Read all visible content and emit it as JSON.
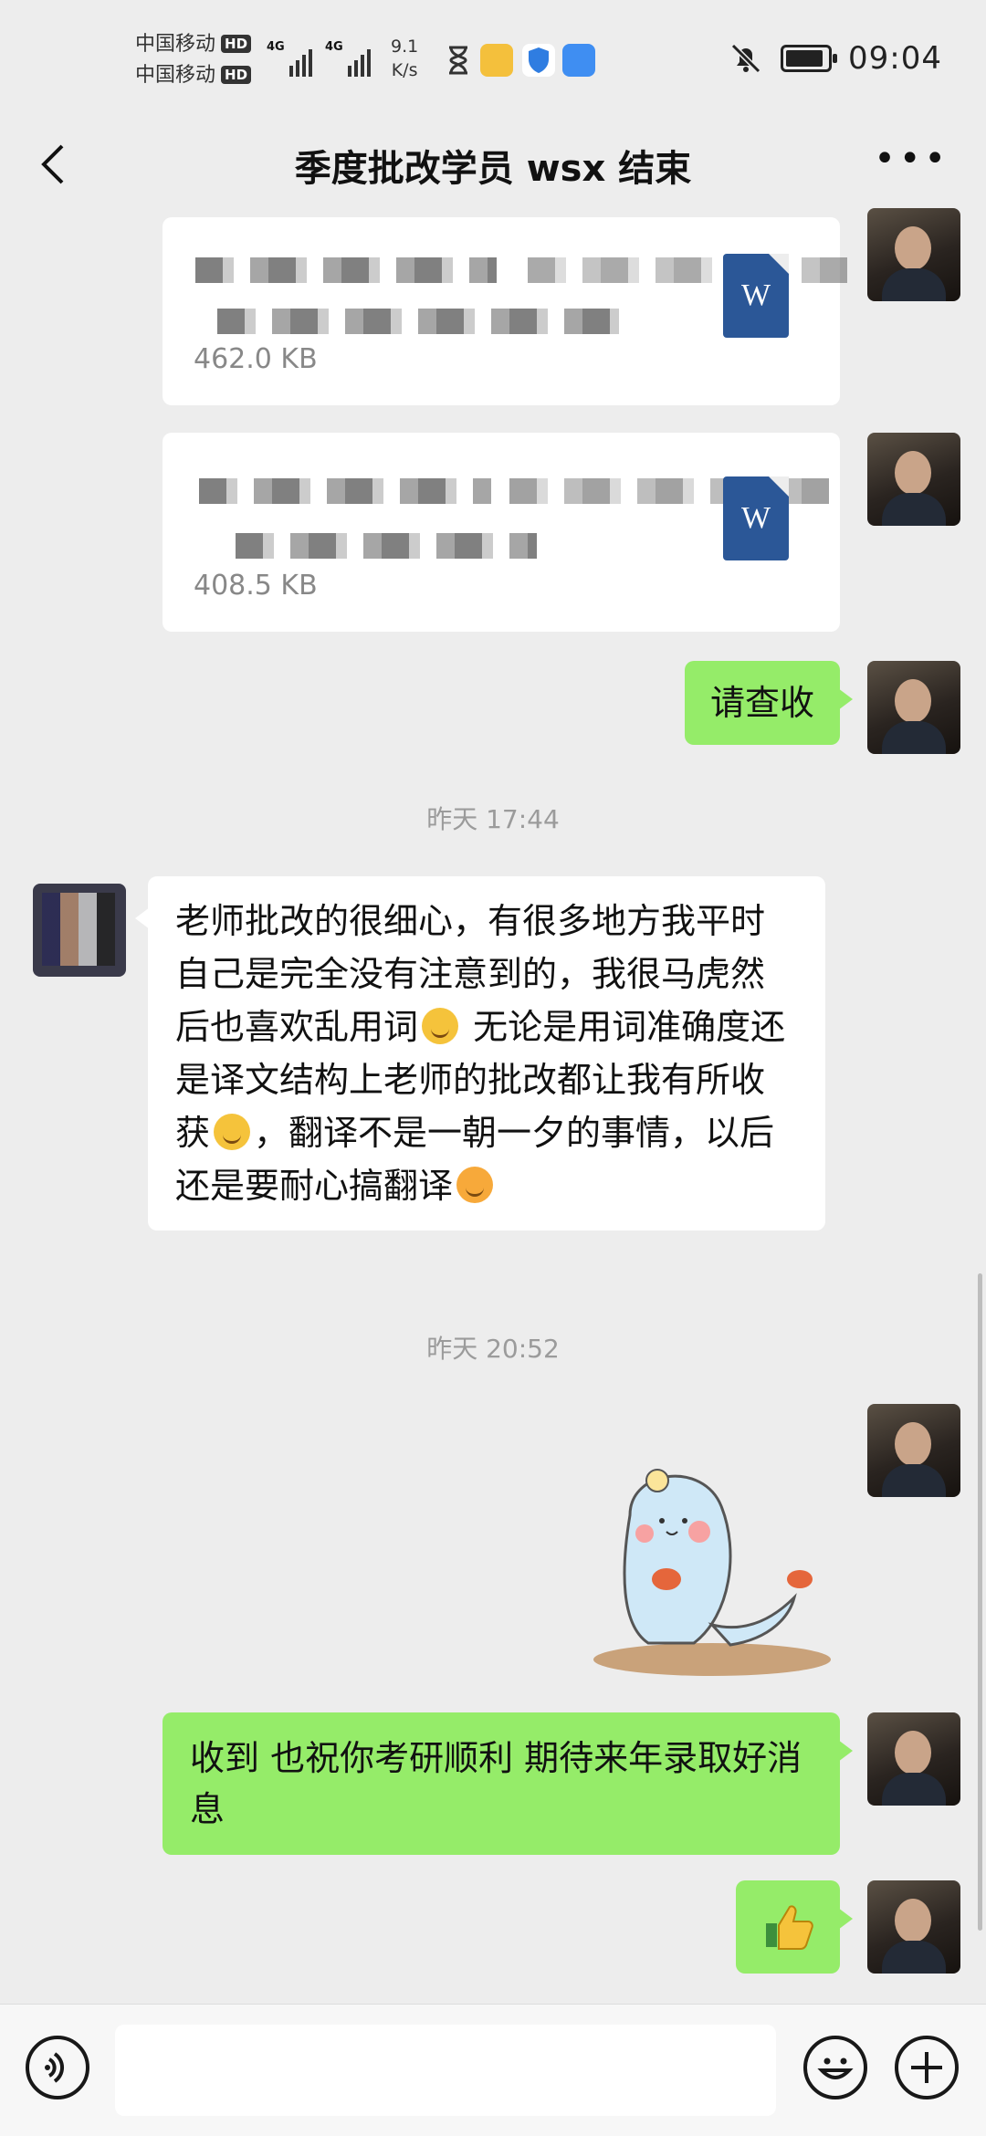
{
  "status_bar": {
    "carrier_1": "中国移动",
    "carrier_2": "中国移动",
    "hd_label": "HD",
    "network_label": "4G",
    "speed_value": "9.1",
    "speed_unit": "K/s",
    "time": "09:04",
    "battery_level": 0.9
  },
  "nav": {
    "title": "季度批改学员 wsx 结束"
  },
  "messages": {
    "file1_size": "462.0 KB",
    "file2_size": "408.5 KB",
    "msg_check": "请查收",
    "timestamp_1": "昨天 17:44",
    "student_text_1": "老师批改的很细心，有很多地方我平时自己是完全没有注意到的，我很马虎然后也喜欢乱用词",
    "student_text_2": " 无论是用词准确度还是译文结构上老师的批改都让我有所收获",
    "student_text_3": "，翻译不是一朝一夕的事情，以后还是要耐心搞翻译",
    "timestamp_2": "昨天 20:52",
    "reply_text": "收到 也祝你考研顺利 期待来年录取好消息",
    "file_icon_letter": "W"
  },
  "colors": {
    "bubble_green": "#95ec69",
    "background": "#ededed",
    "word_blue": "#2b5797"
  },
  "icons": {
    "back": "chevron-left-icon",
    "more": "more-dots-icon",
    "voice": "voice-icon",
    "emoji": "emoji-icon",
    "add": "plus-icon"
  }
}
